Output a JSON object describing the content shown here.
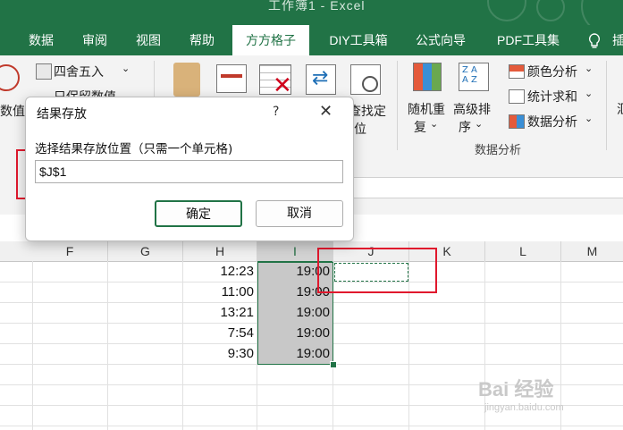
{
  "window": {
    "title": "工作簿1  -  Excel"
  },
  "tabs": [
    {
      "label": "数据"
    },
    {
      "label": "审阅"
    },
    {
      "label": "视图"
    },
    {
      "label": "帮助"
    },
    {
      "label": "方方格子"
    },
    {
      "label": "DIY工具箱"
    },
    {
      "label": "公式向导"
    },
    {
      "label": "PDF工具集"
    },
    {
      "label": "插"
    }
  ],
  "ribbon": {
    "left_frag": "数值",
    "round_label": "四舍五入",
    "keep_label": "只保留数值",
    "find_frag1": "查找定",
    "find_frag2": "位",
    "random_label1": "随机重",
    "random_label2": "复",
    "sort_label1": "高级排",
    "sort_label2": "序",
    "color_analysis": "颜色分析",
    "stat_sum": "统计求和",
    "data_analysis_btn": "数据分析",
    "group_label": "数据分析",
    "right_frag": "汇"
  },
  "columns": [
    "F",
    "G",
    "H",
    "I",
    "J",
    "K",
    "L",
    "M"
  ],
  "selected_column": "I",
  "rows": [
    {
      "H": "12:23",
      "I": "19:00"
    },
    {
      "H": "11:00",
      "I": "19:00"
    },
    {
      "H": "13:21",
      "I": "19:00"
    },
    {
      "H": "7:54",
      "I": "19:00"
    },
    {
      "H": "9:30",
      "I": "19:00"
    }
  ],
  "dialog": {
    "title": "结果存放",
    "help": "?",
    "close": "✕",
    "label": "选择结果存放位置（只需一个单元格)",
    "value": "$J$1",
    "ok": "确定",
    "cancel": "取消"
  },
  "watermark": {
    "text": "Bai 经验",
    "sub": "jingyan.baidu.com"
  },
  "colors": {
    "accent": "#217346",
    "highlight": "#e0182d"
  }
}
